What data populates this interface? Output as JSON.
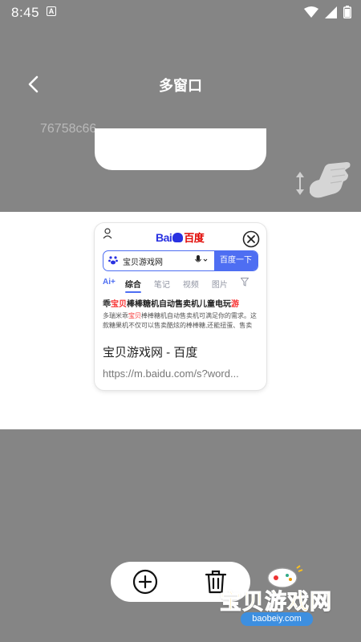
{
  "status_bar": {
    "time": "8:45",
    "notification_letter": "A",
    "icons": [
      "wifi-icon",
      "signal-icon",
      "battery-icon"
    ]
  },
  "header": {
    "title": "多窗口"
  },
  "tabs": {
    "current_tab_id": "76758c66"
  },
  "preview": {
    "logo": {
      "part1": "Bai",
      "part2": "百度"
    },
    "search": {
      "query": "宝贝游戏网",
      "button_label": "百度一下"
    },
    "search_tabs": [
      "Ai+",
      "综合",
      "笔记",
      "视频",
      "图片"
    ],
    "result": {
      "title_pre": "乖",
      "title_hl": "宝贝",
      "title_mid": "棒棒糖机自动售卖机儿童电玩",
      "title_hl2": "游",
      "desc_pre": "多瑞米乖",
      "desc_hl": "宝贝",
      "desc_post": "棒棒糖机自动售卖机可满足你的需求。这款糖果机不仅可以售卖酷炫的棒棒糖,还能扭蛋、售卖"
    },
    "page_title": "宝贝游戏网 - 百度",
    "url": "https://m.baidu.com/s?word..."
  },
  "watermark": {
    "name": "宝贝游戏网",
    "url": "baobeiy.com"
  },
  "colors": {
    "background": "#858585",
    "baidu_blue": "#2932e1",
    "baidu_red": "#e10601",
    "search_blue": "#4e6ef2",
    "highlight_red": "#f73131",
    "watermark_yellow": "#ffc21a"
  }
}
